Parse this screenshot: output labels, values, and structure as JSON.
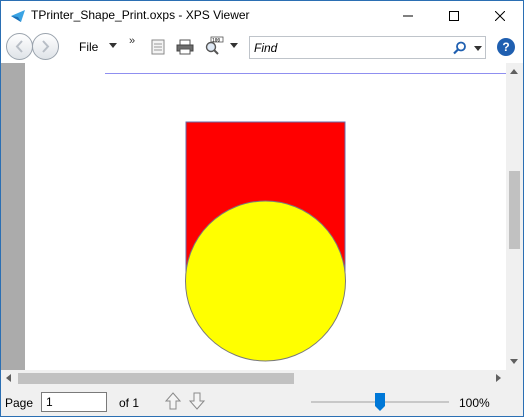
{
  "window": {
    "title": "TPrinter_Shape_Print.oxps - XPS Viewer"
  },
  "toolbar": {
    "file_label": "File",
    "overflow_label": "»",
    "find_placeholder": "Find",
    "find_value": "",
    "icons": [
      "back-icon",
      "forward-icon",
      "document-icon",
      "printer-icon",
      "zoom-icon",
      "search-icon",
      "help-icon"
    ]
  },
  "document": {
    "page_background": "#ffffff",
    "rule_color": "#8f8ff0",
    "shapes": [
      {
        "kind": "rectangle",
        "fill": "#ff0000",
        "stroke": "#6a6aa8"
      },
      {
        "kind": "ellipse",
        "fill": "#ffff00",
        "stroke": "#7a7a7a"
      }
    ]
  },
  "status": {
    "page_label": "Page",
    "page_value": "1",
    "of_label": "of 1",
    "zoom_label": "100%",
    "zoom_fraction": 0.5
  },
  "colors": {
    "accent": "#0078d7",
    "help": "#1f5fb0",
    "frame": "#2b6fb3"
  }
}
